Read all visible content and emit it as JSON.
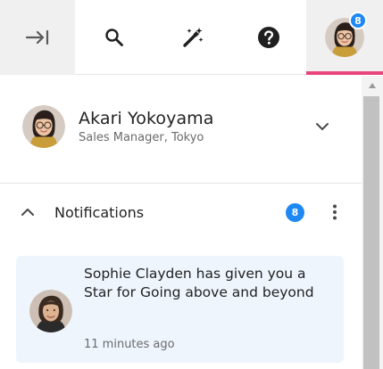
{
  "toolbar": {
    "items": [
      {
        "name": "collapse-panel-button",
        "icon": "arrow-right-to-bar-icon"
      },
      {
        "name": "search-button",
        "icon": "search-icon"
      },
      {
        "name": "magic-wand-button",
        "icon": "magic-wand-icon"
      },
      {
        "name": "help-button",
        "icon": "help-circle-icon"
      },
      {
        "name": "profile-button",
        "icon": "avatar"
      }
    ],
    "profile_badge": "8",
    "active_indicator_color": "#e8467c"
  },
  "user": {
    "name": "Akari Yokoyama",
    "role": "Sales Manager, Tokyo",
    "expand_icon": "chevron-down-icon"
  },
  "notifications": {
    "title": "Notifications",
    "count": "8",
    "collapse_icon": "chevron-up-icon",
    "menu_icon": "more-vertical-icon",
    "items": [
      {
        "message": "Sophie Clayden has given you a Star for Going above and beyond",
        "time": "11 minutes ago"
      }
    ]
  },
  "colors": {
    "badge": "#1e88f5",
    "card_background": "#eef5fd",
    "accent": "#e8467c"
  }
}
